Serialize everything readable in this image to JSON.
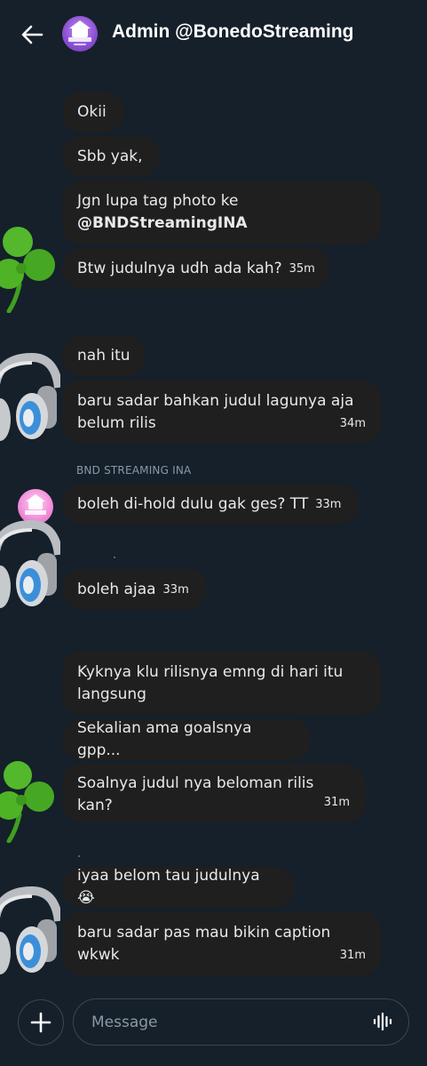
{
  "header": {
    "title": "Admin @BonedoStreaming",
    "back_icon": "arrow-left-icon",
    "avatar_icon": "bonedo-streaming-logo"
  },
  "messages": [
    {
      "text": "Okii",
      "time": ""
    },
    {
      "text": "Sbb yak,",
      "time": ""
    },
    {
      "text_line1": "Jgn lupa tag photo ke",
      "text_line2": "@BNDStreamingINA",
      "time": ""
    },
    {
      "text": "Btw judulnya udh ada kah?",
      "time": "35m"
    },
    {
      "text": "nah itu",
      "time": ""
    },
    {
      "text_line1": "baru sadar bahkan judul lagunya aja",
      "text_line2": "belum rilis",
      "time": "34m"
    },
    {
      "sender": "BND STREAMING INA",
      "text": "boleh di-hold dulu gak ges? TT",
      "time": "33m"
    },
    {
      "text": "boleh ajaa",
      "time": "33m"
    },
    {
      "text_line1": "Kyknya klu rilisnya emng di hari itu",
      "text_line2": "langsung",
      "time": ""
    },
    {
      "text": "Sekalian ama goalsnya gpp...",
      "time": ""
    },
    {
      "text": "Soalnya judul nya beloman rilis kan?",
      "time": "31m"
    },
    {
      "text": "iyaa belom tau judulnya 😭",
      "time": ""
    },
    {
      "text_line1": "baru sadar pas mau bikin caption",
      "text_line2": "wkwk",
      "time": "31m"
    }
  ],
  "avatars": {
    "clover": "shamrock-icon",
    "headphones": "headphones-icon",
    "group": "bonedo-streaming-logo"
  },
  "composer": {
    "placeholder": "Message",
    "add_icon": "plus-icon",
    "voice_icon": "voice-waveform-icon"
  },
  "colors": {
    "background": "#15202b",
    "bubble": "#1f1f1f",
    "text": "#e7e9ea",
    "muted": "#8b98a5"
  }
}
